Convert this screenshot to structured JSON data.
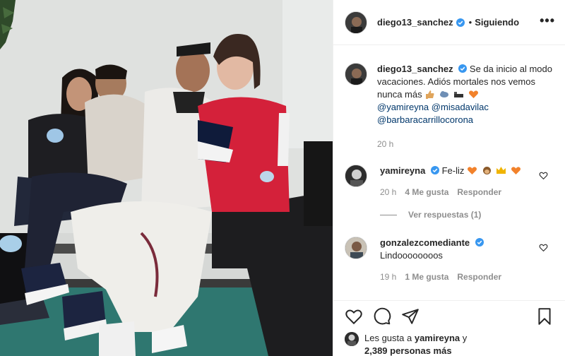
{
  "post": {
    "author": "diego13_sanchez",
    "follow_status": "Siguiendo",
    "more_label": "•••",
    "dot": "•"
  },
  "caption": {
    "username": "diego13_sanchez",
    "text": "Se da inicio al modo vacaciones. Adiós mortales nos vemos nunca más",
    "mentions": [
      "@yamireyna",
      "@misadavilac",
      "@barbaracarrillocorona"
    ],
    "time": "20 h"
  },
  "comments": [
    {
      "username": "yamireyna",
      "text": "Fe-liz",
      "time": "20 h",
      "likes": "4 Me gusta",
      "reply": "Responder",
      "view_replies": "Ver respuestas (1)"
    },
    {
      "username": "gonzalezcomediante",
      "text": "Lindoooooooos",
      "time": "19 h",
      "likes": "1 Me gusta",
      "reply": "Responder"
    }
  ],
  "likes": {
    "prefix": "Les gusta a",
    "user": "yamireyna",
    "joiner": "y",
    "count": "2,389 personas más"
  },
  "colors": {
    "verified": "#3897f0",
    "link": "#00376b",
    "muted": "#8e8e8e",
    "border": "#efefef"
  },
  "icons": [
    "heart-icon",
    "comment-icon",
    "share-icon",
    "bookmark-icon",
    "verified-icon",
    "more-icon"
  ]
}
